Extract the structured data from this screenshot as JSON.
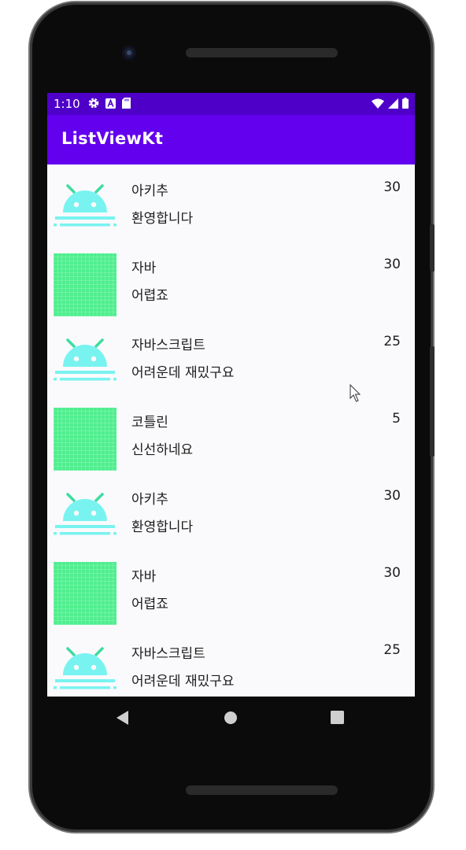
{
  "status_bar": {
    "time": "1:10",
    "left_icons": [
      "gear-icon",
      "a-icon",
      "sd-card-icon"
    ],
    "right_icons": [
      "wifi-icon",
      "signal-icon",
      "battery-icon"
    ]
  },
  "app_bar": {
    "title": "ListViewKt",
    "color": "#6300ee"
  },
  "list": {
    "items": [
      {
        "image": "android-icon",
        "title": "아키추",
        "age": "30",
        "desc": "환영합니다"
      },
      {
        "image": "green-pattern",
        "title": "자바",
        "age": "30",
        "desc": "어렵죠"
      },
      {
        "image": "android-icon",
        "title": "자바스크립트",
        "age": "25",
        "desc": "어려운데 재밌구요"
      },
      {
        "image": "green-pattern",
        "title": "코틀린",
        "age": "5",
        "desc": "신선하네요"
      },
      {
        "image": "android-icon",
        "title": "아키추",
        "age": "30",
        "desc": "환영합니다"
      },
      {
        "image": "green-pattern",
        "title": "자바",
        "age": "30",
        "desc": "어렵죠"
      },
      {
        "image": "android-icon",
        "title": "자바스크립트",
        "age": "25",
        "desc": "어려운데 재밌구요"
      }
    ]
  },
  "nav_bar": {
    "buttons": [
      "back-icon",
      "home-icon",
      "recents-icon"
    ]
  }
}
